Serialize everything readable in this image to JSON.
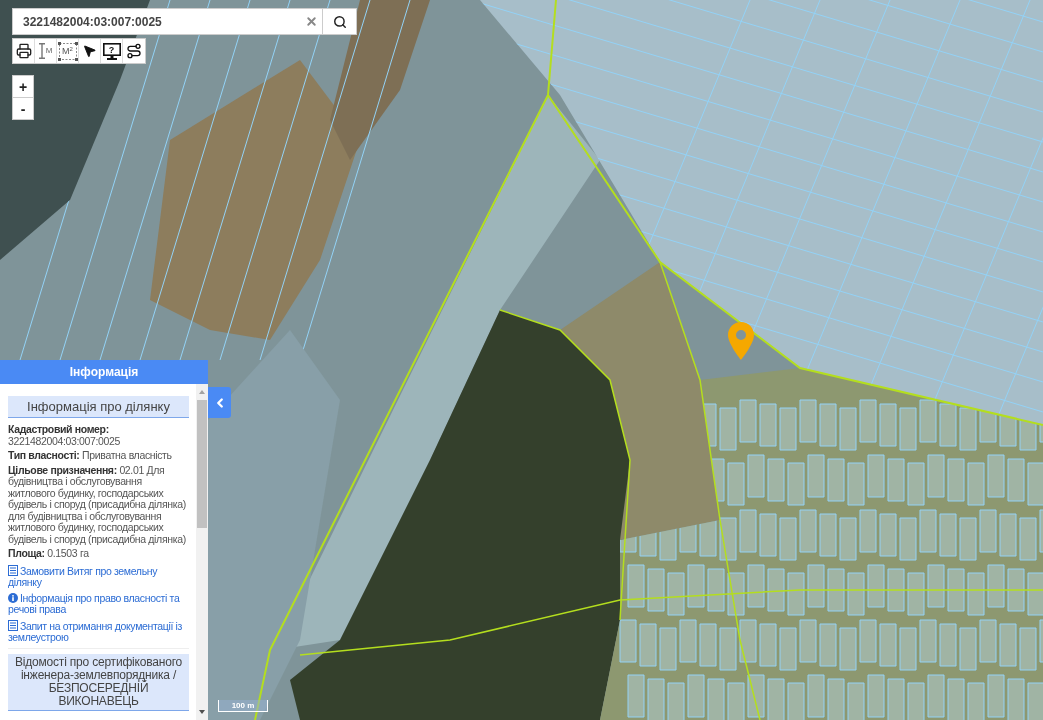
{
  "search": {
    "value": "3221482004:03:007:0025"
  },
  "toolbar": [
    {
      "kind": "print"
    },
    {
      "kind": "measure_length",
      "label": "M"
    },
    {
      "kind": "measure_area",
      "label": "M$^{2}$"
    },
    {
      "kind": "select"
    },
    {
      "kind": "info",
      "label": "?"
    },
    {
      "kind": "route"
    }
  ],
  "zoom": {
    "in": "+",
    "out": "-"
  },
  "info_panel": {
    "title": "Інформація",
    "section_title": "Інформація про ділянку",
    "fields": [
      {
        "label": "Кадастровий номер:",
        "value": "3221482004:03:007:0025"
      },
      {
        "label": "Тип власності:",
        "value": "Приватна власність"
      },
      {
        "label": "Цільове призначення:",
        "value": "02.01 Для будівництва і обслуговування житлового будинку, господарських будівель і споруд (присадибна ділянка) для будівництва і обслуговування житлового будинку, господарських будівель і споруд (присадибна ділянка)"
      },
      {
        "label": "Площа:",
        "value": "0.1503 га"
      }
    ],
    "links": [
      {
        "kind": "document",
        "text": "Замовити Витяг про земельну ділянку"
      },
      {
        "kind": "info",
        "text": "Інформація про право власності та речові права"
      },
      {
        "kind": "document",
        "text": "Запит на отримання документації із землеустрою"
      }
    ],
    "engineer_section_title": "Відомості про сертифікованого інженера-землевпорядника / БЕЗПОСЕРЕДНІЙ ВИКОНАВЕЦЬ"
  },
  "map": {
    "scale": "100 m"
  }
}
